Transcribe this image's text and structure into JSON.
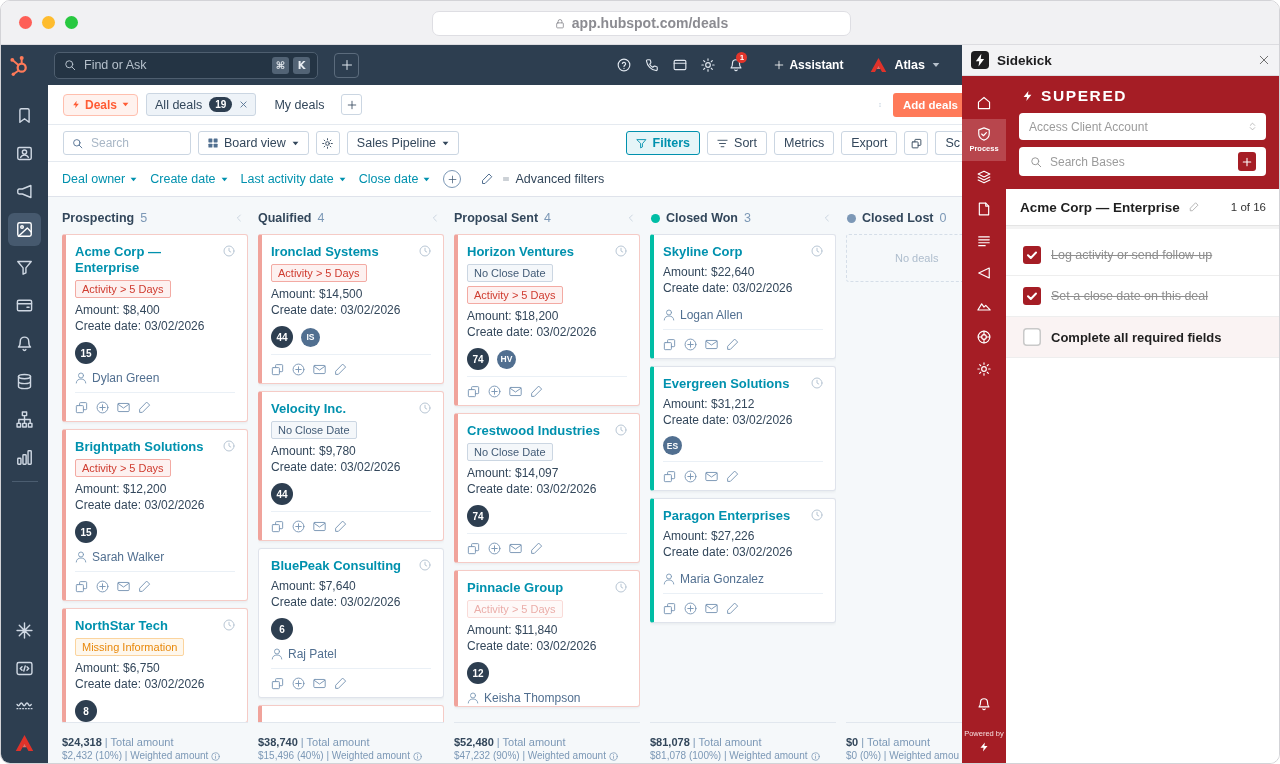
{
  "browser": {
    "url": "app.hubspot.com/deals"
  },
  "top_nav": {
    "search": {
      "placeholder": "Find or Ask",
      "shortcut": [
        "⌘",
        "K"
      ]
    },
    "notification_count": "1",
    "assistant": "Assistant",
    "account": "Atlas"
  },
  "sidebar": {
    "items": [
      {
        "selected": false
      },
      {
        "selected": false
      },
      {
        "selected": false
      },
      {
        "selected": true
      },
      {
        "selected": false
      },
      {
        "selected": false
      },
      {
        "selected": false
      },
      {
        "selected": false
      },
      {
        "selected": false
      },
      {
        "selected": false
      }
    ],
    "bottom_items": [
      {
        "selected": false
      },
      {
        "selected": false
      },
      {
        "selected": false
      }
    ]
  },
  "deals_header": {
    "object_menu": "Deals",
    "views": [
      {
        "label": "All deals",
        "count": "19",
        "selected": true,
        "closable": true
      },
      {
        "label": "My deals",
        "selected": false,
        "closable": false
      }
    ],
    "add_button": "Add deals"
  },
  "toolbar": {
    "search": {
      "placeholder": "Search"
    },
    "view_menu": "Board view",
    "pipeline_menu": "Sales Pipeline",
    "actions": [
      {
        "kind": "filter",
        "label": "Filters",
        "active": true
      },
      {
        "kind": "sort",
        "label": "Sort",
        "active": false
      },
      {
        "kind": "text",
        "label": "Metrics",
        "active": false
      },
      {
        "kind": "text",
        "label": "Export",
        "active": false
      },
      {
        "kind": "duplicate",
        "active": false
      },
      {
        "kind": "text",
        "label": "Sc",
        "active": false
      }
    ]
  },
  "filter_bar": {
    "filters": [
      "Deal owner",
      "Create date",
      "Last activity date",
      "Close date"
    ],
    "advanced": "Advanced filters"
  },
  "board": {
    "columns": [
      {
        "name": "Prospecting",
        "count": "5",
        "collapsible": true,
        "cards": [
          {
            "name": "Acme Corp — Enterprise",
            "flagged": true,
            "tags": [
              {
                "text": "Activity > 5 Days",
                "kind": "danger",
                "faded": false
              }
            ],
            "amount": "Amount: $8,400",
            "created": "Create date: 03/02/2026",
            "badges": [
              {
                "text": "15",
                "kind": "score"
              }
            ],
            "owner": "Dylan Green"
          },
          {
            "name": "Brightpath Solutions",
            "flagged": true,
            "tags": [
              {
                "text": "Activity > 5 Days",
                "kind": "danger",
                "faded": false
              }
            ],
            "amount": "Amount: $12,200",
            "created": "Create date: 03/02/2026",
            "badges": [
              {
                "text": "15",
                "kind": "score"
              }
            ],
            "owner": "Sarah Walker"
          },
          {
            "name": "NorthStar Tech",
            "flagged": true,
            "tags": [
              {
                "text": "Missing Information",
                "kind": "warning",
                "faded": false
              }
            ],
            "amount": "Amount: $6,750",
            "created": "Create date: 03/02/2026",
            "badges": [
              {
                "text": "8",
                "kind": "score"
              }
            ]
          }
        ],
        "total": "**$24,318** | Total amount",
        "weighted": "$2,432 (10%) | Weighted amount",
        "info": true
      },
      {
        "name": "Qualified",
        "count": "4",
        "collapsible": true,
        "cards": [
          {
            "name": "Ironclad Systems",
            "flagged": true,
            "tags": [
              {
                "text": "Activity > 5 Days",
                "kind": "danger",
                "faded": false
              }
            ],
            "amount": "Amount: $14,500",
            "created": "Create date: 03/02/2026",
            "badges": [
              {
                "text": "44",
                "kind": "score"
              },
              {
                "text": "IS",
                "kind": "initials"
              }
            ]
          },
          {
            "name": "Velocity Inc.",
            "flagged": true,
            "tags": [
              {
                "text": "No Close Date",
                "kind": "neutral",
                "faded": false
              }
            ],
            "amount": "Amount: $9,780",
            "created": "Create date: 03/02/2026",
            "badges": [
              {
                "text": "44",
                "kind": "score"
              }
            ]
          },
          {
            "name": "BluePeak Consulting",
            "flagged": false,
            "amount": "Amount: $7,640",
            "created": "Create date: 03/02/2026",
            "badges": [
              {
                "text": "6",
                "kind": "score"
              }
            ],
            "owner": "Raj Patel"
          },
          {
            "flagged": true
          }
        ],
        "total": "**$38,740** | Total amount",
        "weighted": "$15,496 (40%) | Weighted amount",
        "info": true
      },
      {
        "name": "Proposal Sent",
        "count": "4",
        "collapsible": true,
        "cards": [
          {
            "name": "Horizon Ventures",
            "flagged": true,
            "tags": [
              {
                "text": "No Close Date",
                "kind": "neutral",
                "faded": false
              },
              {
                "text": "Activity > 5 Days",
                "kind": "danger",
                "faded": false
              }
            ],
            "amount": "Amount: $18,200",
            "created": "Create date: 03/02/2026",
            "badges": [
              {
                "text": "74",
                "kind": "score"
              },
              {
                "text": "HV",
                "kind": "initials"
              }
            ]
          },
          {
            "name": "Crestwood Industries",
            "flagged": true,
            "tags": [
              {
                "text": "No Close Date",
                "kind": "neutral",
                "faded": false
              }
            ],
            "amount": "Amount: $14,097",
            "created": "Create date: 03/02/2026",
            "badges": [
              {
                "text": "74",
                "kind": "score"
              }
            ]
          },
          {
            "name": "Pinnacle Group",
            "flagged": true,
            "tags": [
              {
                "text": "Activity > 5 Days",
                "kind": "danger",
                "faded": true
              }
            ],
            "amount": "Amount: $11,840",
            "created": "Create date: 03/02/2026",
            "badges": [
              {
                "text": "12",
                "kind": "score"
              }
            ],
            "owner": "Keisha Thompson"
          }
        ],
        "total": "**$52,480** | Total amount",
        "weighted": "$47,232 (90%) | Weighted amount",
        "info": true
      },
      {
        "name": "Closed Won",
        "count": "3",
        "color": "#00bda5",
        "collapsible": true,
        "cards": [
          {
            "name": "Skyline Corp",
            "flagged": false,
            "amount": "Amount: $22,640",
            "created": "Create date: 03/02/2026",
            "owner": "Logan Allen"
          },
          {
            "name": "Evergreen Solutions",
            "flagged": false,
            "amount": "Amount: $31,212",
            "created": "Create date: 03/02/2026",
            "badges": [
              {
                "text": "ES",
                "kind": "initials"
              }
            ]
          },
          {
            "name": "Paragon Enterprises",
            "flagged": false,
            "amount": "Amount: $27,226",
            "created": "Create date: 03/02/2026",
            "owner": "Maria Gonzalez"
          }
        ],
        "total": "**$81,078** | Total amount",
        "weighted": "$81,078 (100%) | Weighted amount",
        "info": true
      },
      {
        "name": "Closed Lost",
        "count": "0",
        "color": "#7c98b6",
        "empty": "No deals",
        "total": "**$0** | Total amount",
        "weighted": "$0 (0%) | Weighted amou"
      }
    ]
  },
  "sidekick": {
    "title": "Sidekick",
    "rail": [
      {
        "selected": false
      },
      {
        "label": "Process",
        "selected": true
      },
      {
        "selected": false
      },
      {
        "selected": false
      },
      {
        "selected": false
      },
      {
        "selected": false
      },
      {
        "selected": false
      },
      {
        "selected": false
      },
      {
        "selected": false
      }
    ],
    "powered_by": "Powered by",
    "brand": "SUPERED",
    "account_select": {
      "placeholder": "Access Client Account"
    },
    "base_search": {
      "placeholder": "Search Bases"
    },
    "record": {
      "title": "Acme Corp — Enterprise",
      "position": "1 of 16"
    },
    "tasks": [
      {
        "label": "Log activity or send follow-up",
        "checked": true,
        "highlighted": false
      },
      {
        "label": "Set a close date on this deal",
        "checked": true,
        "highlighted": false
      },
      {
        "label": "Complete all required fields",
        "checked": false,
        "highlighted": true
      }
    ]
  }
}
